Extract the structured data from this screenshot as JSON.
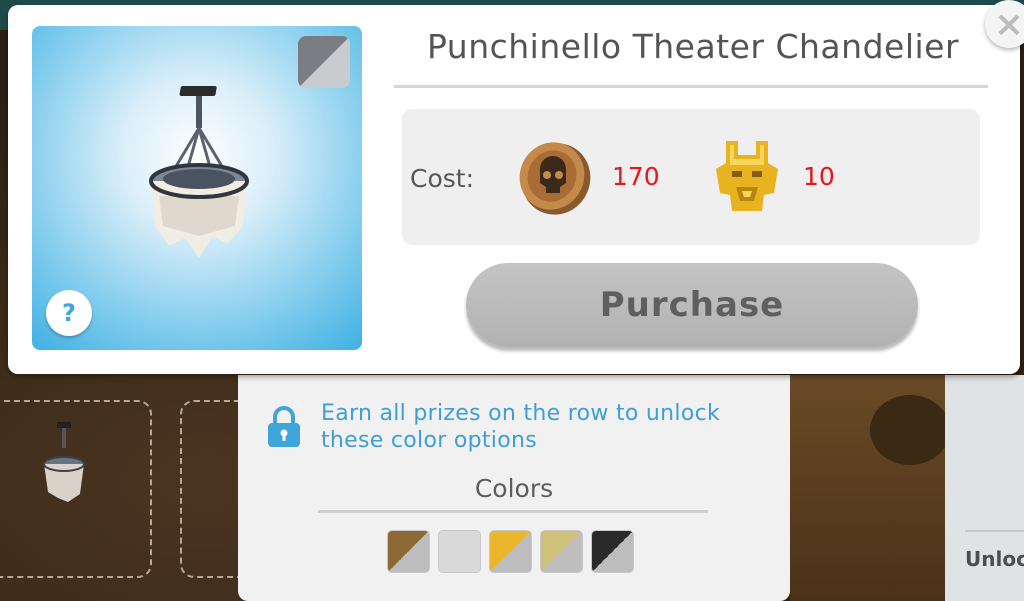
{
  "dialog": {
    "title": "Punchinello Theater Chandelier",
    "cost_label": "Cost:",
    "costs": [
      {
        "currency_icon": "skull-coin-icon",
        "amount": "170"
      },
      {
        "currency_icon": "golden-mask-icon",
        "amount": "10"
      }
    ],
    "purchase_label": "Purchase",
    "help_label": "?",
    "close_glyph": "×"
  },
  "colors_panel": {
    "unlock_message": "Earn all prizes on the row to unlock these color options",
    "title": "Colors",
    "swatches": [
      {
        "primary": "#8c6a35",
        "secondary": "#bdbdbd"
      },
      {
        "primary": "#d9d9d9",
        "secondary": "#d9d9d9"
      },
      {
        "primary": "#e9b62c",
        "secondary": "#bdbdbd"
      },
      {
        "primary": "#cfc07a",
        "secondary": "#bdbdbd"
      },
      {
        "primary": "#2a2a2a",
        "secondary": "#bdbdbd"
      }
    ]
  },
  "background": {
    "partial_button_text": "Unlock"
  },
  "theme": {
    "accent_blue": "#3fa6dc",
    "cost_red": "#e8151b",
    "disabled_button": "#b8b8b8"
  }
}
